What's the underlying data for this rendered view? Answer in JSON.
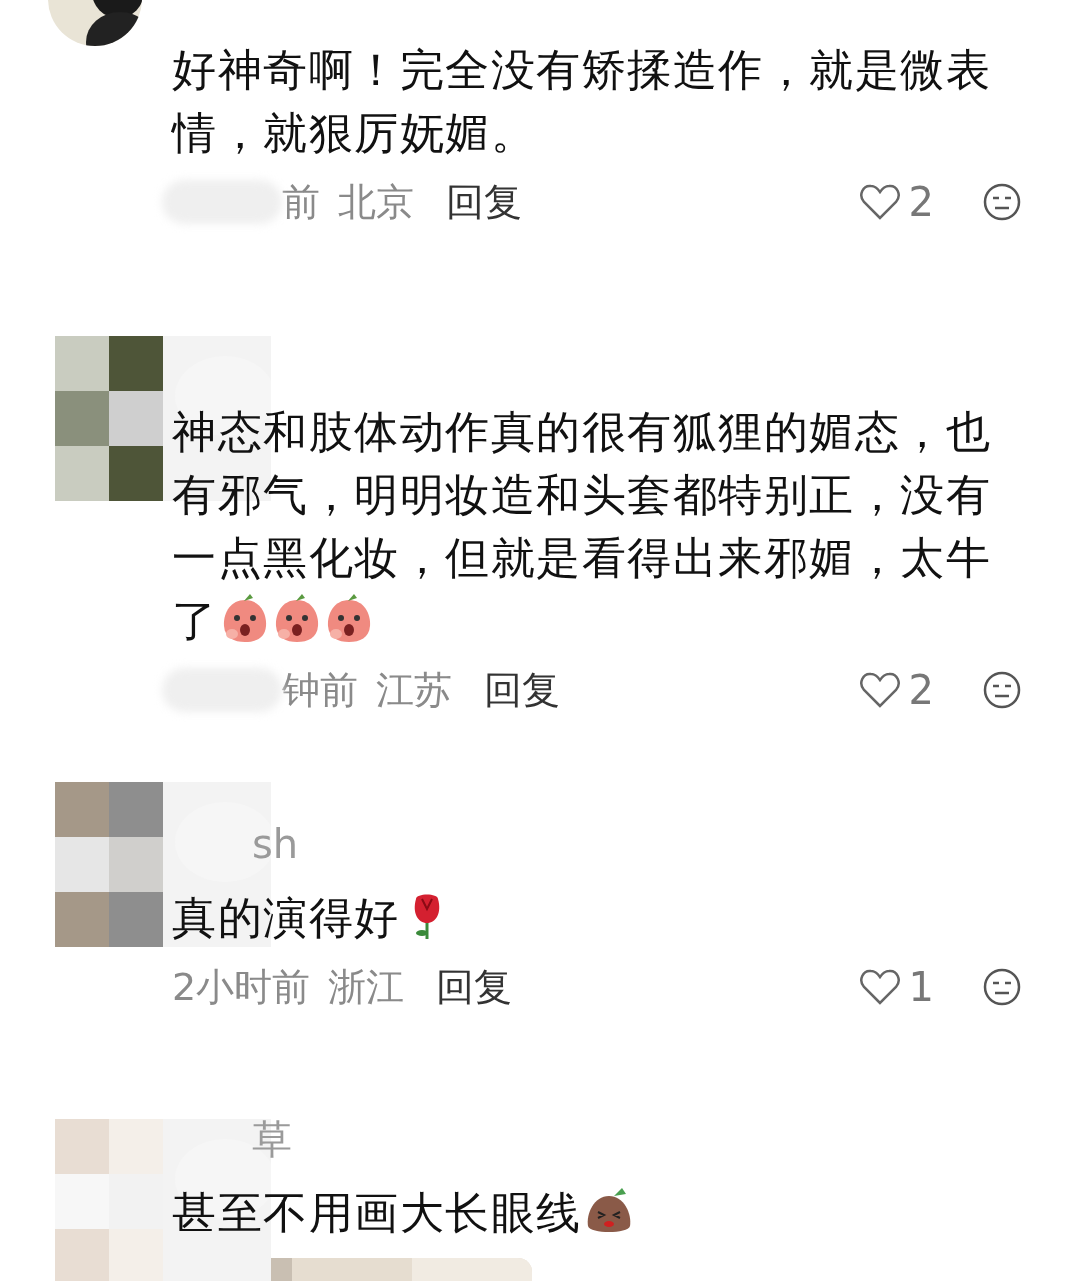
{
  "comments": [
    {
      "text": "好神奇啊！完全没有矫揉造作，就是微表情，就狠厉妩媚。",
      "time": "前",
      "time_censored": true,
      "location": "北京",
      "reply": "回复",
      "likes": "2"
    },
    {
      "avatar": {
        "kind": "mosaic"
      },
      "text": "神态和肢体动作真的很有狐狸的媚态，也有邪气，明明妆造和头套都特别正，没有一点黑化妆，但就是看得出来邪媚，太牛了",
      "emojis": [
        {
          "kind": "peach"
        },
        {
          "kind": "peach"
        },
        {
          "kind": "peach"
        }
      ],
      "time": "钟前",
      "time_censored": true,
      "location": "江苏",
      "reply": "回复",
      "likes": "2"
    },
    {
      "avatar": {
        "kind": "mosaic"
      },
      "name": "sh",
      "text": "真的演得好",
      "emojis": [
        {
          "kind": "rose"
        }
      ],
      "time": "2小时前",
      "time_censored": false,
      "location": "浙江",
      "reply": "回复",
      "likes": "1"
    },
    {
      "avatar": {
        "kind": "mosaic"
      },
      "name": "草",
      "text": "甚至不用画大长眼线",
      "emojis": [
        {
          "kind": "bean"
        }
      ]
    }
  ]
}
